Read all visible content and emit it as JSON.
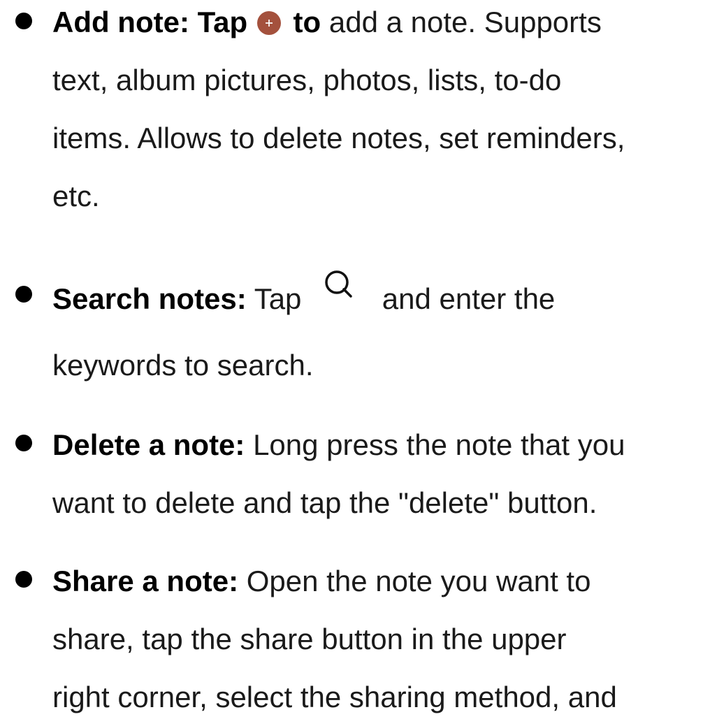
{
  "colors": {
    "add_icon": "#a4513d",
    "text": "#1a1a1a",
    "bullet": "#000000"
  },
  "items": [
    {
      "title": "Add note: Tap",
      "title_suffix": "to",
      "line1_rest": "add a note. Supports",
      "line2": "text, album pictures, photos, lists, to-do",
      "line3": "items. Allows to delete notes, set reminders,",
      "line4": "etc.",
      "icon": "add-circle-icon"
    },
    {
      "title": "Search notes:",
      "line1_pre": "Tap",
      "line1_rest": "and enter the",
      "line2": "keywords to search.",
      "icon": "search-icon"
    },
    {
      "title": "Delete a note:",
      "line1_rest": "Long press the note that you",
      "line2": "want to delete and tap the \"delete\" button."
    },
    {
      "title": "Share a note:",
      "line1_rest": "Open the note you want to",
      "line2": "share, tap the share button in the upper",
      "line3": "right corner, select the sharing method, and"
    }
  ]
}
